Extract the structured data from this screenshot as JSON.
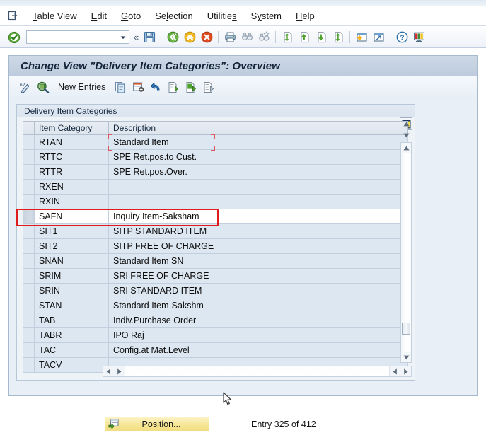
{
  "window": {
    "title": "Change View \"Delivery Item Categories\": Overview"
  },
  "menubar": {
    "system_icon": "window-menu-icon",
    "items": [
      {
        "label": "Table View",
        "accel": "T"
      },
      {
        "label": "Edit",
        "accel": "E"
      },
      {
        "label": "Goto",
        "accel": "G"
      },
      {
        "label": "Selection",
        "accel": "l"
      },
      {
        "label": "Utilities",
        "accel": "s"
      },
      {
        "label": "System",
        "accel": "y"
      },
      {
        "label": "Help",
        "accel": "H"
      }
    ]
  },
  "system_toolbar": {
    "enter_button": "enter-check-icon",
    "command_field": {
      "value": "",
      "placeholder": ""
    },
    "command_dropdown": "chevron-down-icon",
    "collapse_toggle": "«",
    "buttons": [
      {
        "name": "save-button",
        "icon": "floppy-disk-icon"
      },
      {
        "name": "back-button",
        "icon": "green-back-arrow-icon"
      },
      {
        "name": "exit-button",
        "icon": "yellow-up-arrow-icon"
      },
      {
        "name": "cancel-button",
        "icon": "red-cancel-icon"
      },
      {
        "name": "print-button",
        "icon": "printer-icon"
      },
      {
        "name": "find-button",
        "icon": "binoculars-icon"
      },
      {
        "name": "find-next-button",
        "icon": "binoculars-plus-icon"
      },
      {
        "name": "first-page-button",
        "icon": "page-first-icon"
      },
      {
        "name": "previous-page-button",
        "icon": "page-up-icon"
      },
      {
        "name": "next-page-button",
        "icon": "page-down-icon"
      },
      {
        "name": "last-page-button",
        "icon": "page-last-icon"
      },
      {
        "name": "create-session-button",
        "icon": "new-session-icon"
      },
      {
        "name": "create-shortcut-button",
        "icon": "shortcut-icon"
      },
      {
        "name": "help-button",
        "icon": "question-help-icon"
      },
      {
        "name": "customize-layout-button",
        "icon": "layout-monitor-icon"
      }
    ]
  },
  "app_toolbar": {
    "items": [
      {
        "name": "select-all-details-button",
        "icon": "pencil-detail-icon",
        "label": ""
      },
      {
        "name": "display-details-button",
        "icon": "magnifier-detail-icon",
        "label": ""
      },
      {
        "name": "new-entries-button",
        "icon": "",
        "label": "New Entries"
      },
      {
        "name": "copy-as-button",
        "icon": "copy-page-icon",
        "label": ""
      },
      {
        "name": "delete-button",
        "icon": "delete-row-icon",
        "label": ""
      },
      {
        "name": "undo-button",
        "icon": "undo-arrow-icon",
        "label": ""
      },
      {
        "name": "previous-entry-button",
        "icon": "page-prev-entry-icon",
        "label": ""
      },
      {
        "name": "next-entry-button",
        "icon": "page-next-entry-icon",
        "label": ""
      },
      {
        "name": "other-entry-button",
        "icon": "page-other-entry-icon",
        "label": ""
      }
    ]
  },
  "group": {
    "title": "Delivery Item Categories"
  },
  "table": {
    "columns": [
      "Item Category",
      "Description"
    ],
    "column_config_icon": "table-settings-icon",
    "highlighted_key": "SAFN",
    "focused_cell": {
      "row": 0,
      "column": 1,
      "value": "Standard Item"
    },
    "rows": [
      {
        "key": "RTAN",
        "desc": "Standard Item"
      },
      {
        "key": "RTTC",
        "desc": "SPE Ret.pos.to Cust."
      },
      {
        "key": "RTTR",
        "desc": "SPE Ret.pos.Over."
      },
      {
        "key": "RXEN",
        "desc": ""
      },
      {
        "key": "RXIN",
        "desc": ""
      },
      {
        "key": "SAFN",
        "desc": "Inquiry Item-Saksham"
      },
      {
        "key": "SIT1",
        "desc": "SITP STANDARD ITEM"
      },
      {
        "key": "SIT2",
        "desc": "SITP FREE OF CHARGE"
      },
      {
        "key": "SNAN",
        "desc": "Standard Item SN"
      },
      {
        "key": "SRIM",
        "desc": "SRI FREE OF CHARGE"
      },
      {
        "key": "SRIN",
        "desc": "SRI STANDARD ITEM"
      },
      {
        "key": "STAN",
        "desc": "Standard Item-Sakshm"
      },
      {
        "key": "TAB",
        "desc": "Indiv.Purchase Order"
      },
      {
        "key": "TABR",
        "desc": "IPO Raj"
      },
      {
        "key": "TAC",
        "desc": "Config.at Mat.Level"
      },
      {
        "key": "TACV",
        "desc": ""
      }
    ]
  },
  "scrollbars": {
    "vertical": {
      "up_icon": "scroll-up-arrow-icon",
      "down_icon": "scroll-down-arrow-icon"
    },
    "horizontal": {
      "left_icon": "scroll-left-arrow-icon",
      "right_icon": "scroll-right-arrow-icon"
    }
  },
  "footer": {
    "position_button": {
      "label": "Position...",
      "icon": "position-jump-icon"
    },
    "entry_status": "Entry 325 of 412"
  },
  "colors": {
    "accent_highlight": "#e01b1b",
    "title_bar": "#c5d2e0",
    "grid_row": "#dde7f1",
    "button_yellow": "#f4e49a",
    "focus_marker": "#e0585f"
  }
}
